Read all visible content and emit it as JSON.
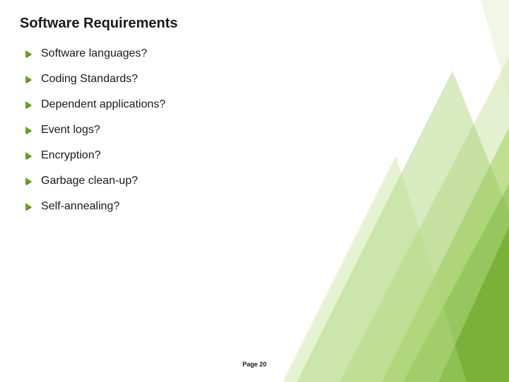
{
  "title": "Software Requirements",
  "bullets": [
    "Software languages?",
    "Coding Standards?",
    "Dependent applications?",
    "Event logs?",
    "Encryption?",
    "Garbage clean-up?",
    "Self-annealing?"
  ],
  "page_label": "Page 20",
  "colors": {
    "accent": "#6aa31f"
  }
}
